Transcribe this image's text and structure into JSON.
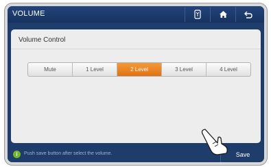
{
  "header": {
    "title": "VOLUME"
  },
  "toolbar": {
    "icons": [
      "phone-icon",
      "home-icon",
      "back-icon"
    ]
  },
  "panel": {
    "title": "Volume Control",
    "levels": [
      "Mute",
      "1 Level",
      "2 Level",
      "3 Level",
      "4 Level"
    ],
    "selected": "2 Level"
  },
  "footer": {
    "info_icon": "i",
    "hint": "Push save button after select the volume.",
    "save_label": "Save"
  },
  "colors": {
    "topbar": "#1f3d6b",
    "accent": "#e8801f",
    "info": "#6fb82d"
  }
}
